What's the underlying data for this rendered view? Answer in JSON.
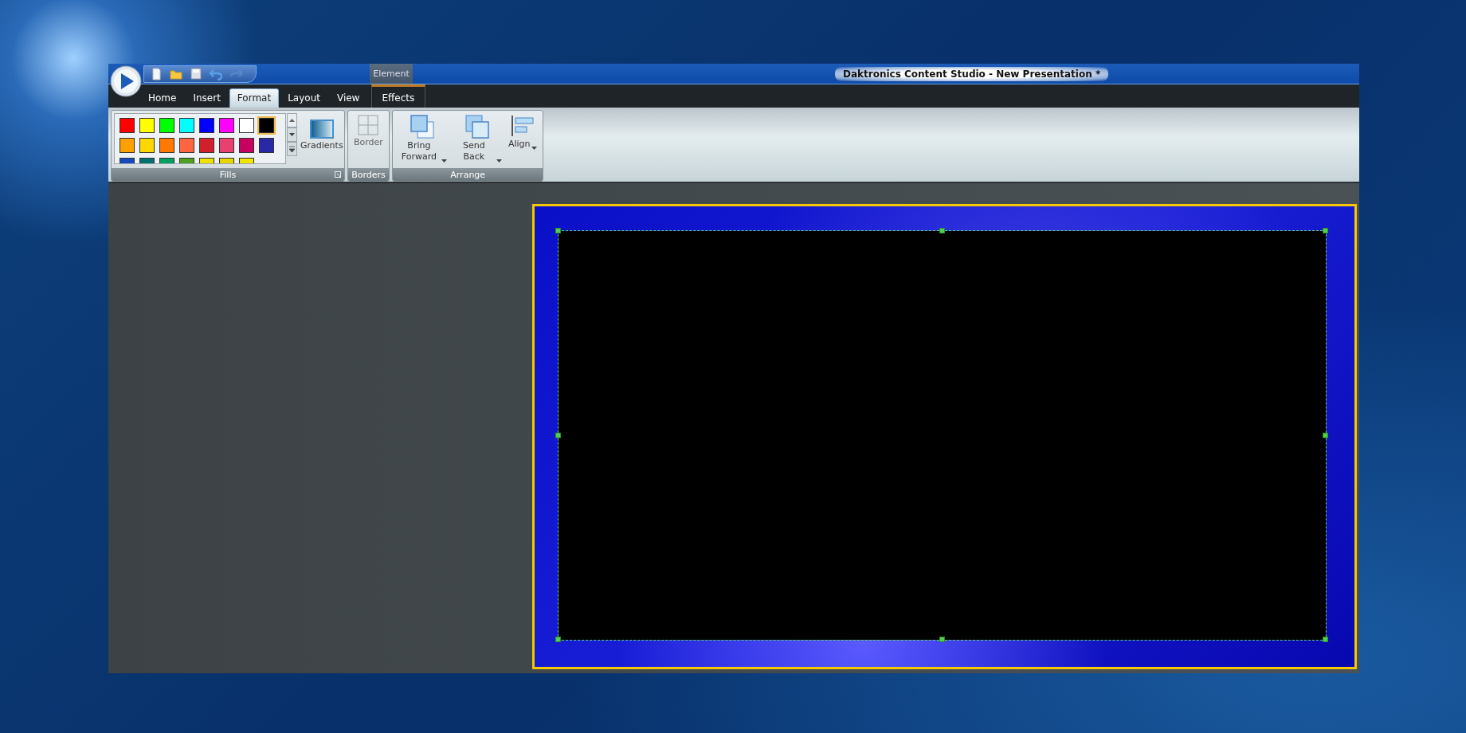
{
  "window": {
    "title": "Daktronics Content Studio - New Presentation *"
  },
  "tabs": [
    {
      "label": "Home",
      "selected": false
    },
    {
      "label": "Insert",
      "selected": false
    },
    {
      "label": "Format",
      "selected": true
    },
    {
      "label": "Layout",
      "selected": false
    },
    {
      "label": "View",
      "selected": false
    }
  ],
  "contextual_group": {
    "label": "Element",
    "tabs": [
      {
        "label": "Effects",
        "selected": false
      }
    ]
  },
  "ribbon": {
    "groups": [
      {
        "kind": "fills",
        "label": "Fills",
        "swatches": [
          {
            "color": "#ff0000",
            "selected": false
          },
          {
            "color": "#ffff00",
            "selected": false
          },
          {
            "color": "#00ff00",
            "selected": false
          },
          {
            "color": "#00ffff",
            "selected": false
          },
          {
            "color": "#0000ff",
            "selected": false
          },
          {
            "color": "#ff00ff",
            "selected": false
          },
          {
            "color": "#ffffff",
            "selected": false
          },
          {
            "color": "#000000",
            "selected": true
          },
          {
            "color": "#ffa000",
            "selected": false
          },
          {
            "color": "#ffd700",
            "selected": false
          },
          {
            "color": "#ff7800",
            "selected": false
          },
          {
            "color": "#ff6440",
            "selected": false
          },
          {
            "color": "#d0202c",
            "selected": false
          },
          {
            "color": "#e84070",
            "selected": false
          },
          {
            "color": "#c80060",
            "selected": false
          },
          {
            "color": "#2828a8",
            "selected": false
          },
          {
            "color": "#1848c0",
            "selected": false
          },
          {
            "color": "#007070",
            "selected": false
          },
          {
            "color": "#00a060",
            "selected": false
          },
          {
            "color": "#50a020",
            "selected": false
          },
          {
            "color": "#f0e000",
            "selected": false
          },
          {
            "color": "#e8d400",
            "selected": false
          },
          {
            "color": "#f0e400",
            "selected": false
          }
        ],
        "buttons": [
          {
            "kind": "gradients",
            "label": "Gradients"
          }
        ]
      },
      {
        "kind": "borders",
        "label": "Borders",
        "buttons": [
          {
            "kind": "border",
            "label": "Border"
          }
        ]
      },
      {
        "kind": "arrange",
        "label": "Arrange",
        "buttons": [
          {
            "kind": "forward",
            "label": "Bring Forward"
          },
          {
            "kind": "back",
            "label": "Send Back"
          },
          {
            "kind": "align",
            "label": "Align"
          }
        ]
      }
    ]
  }
}
